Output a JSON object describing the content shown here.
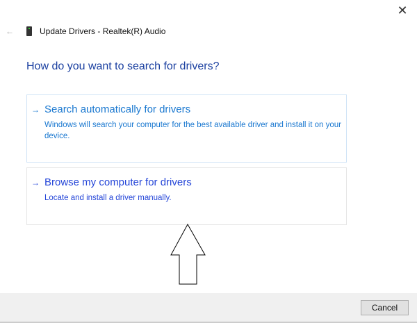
{
  "window": {
    "title": "Update Drivers - Realtek(R) Audio",
    "close_icon": "close-icon",
    "back_icon": "back-arrow-icon"
  },
  "heading": "How do you want to search for drivers?",
  "options": [
    {
      "arrow": "→",
      "title": "Search automatically for drivers",
      "description": "Windows will search your computer for the best available driver and install it on your device."
    },
    {
      "arrow": "→",
      "title": "Browse my computer for drivers",
      "description": "Locate and install a driver manually."
    }
  ],
  "footer": {
    "cancel_label": "Cancel"
  }
}
